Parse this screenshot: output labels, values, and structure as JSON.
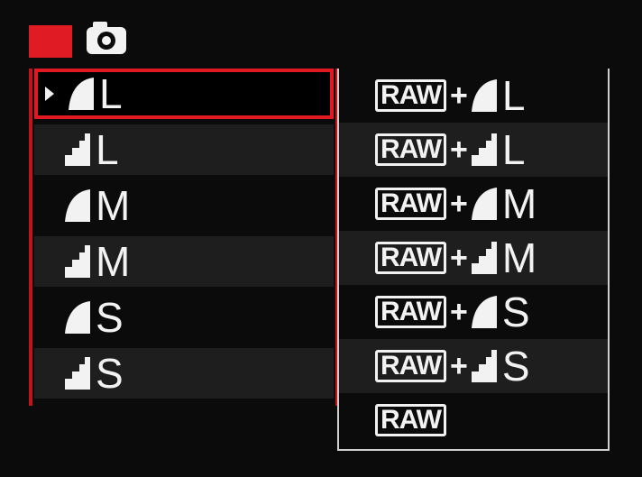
{
  "tabs": {
    "active_tab_color": "#e11b24",
    "camera_icon": "camera-icon"
  },
  "quality_menu": {
    "left_items": [
      {
        "size": "L",
        "quality": "fine"
      },
      {
        "size": "L",
        "quality": "normal"
      },
      {
        "size": "M",
        "quality": "fine"
      },
      {
        "size": "M",
        "quality": "normal"
      },
      {
        "size": "S",
        "quality": "fine"
      },
      {
        "size": "S",
        "quality": "normal"
      }
    ],
    "right_items": [
      {
        "raw": "RAW",
        "plus": "+",
        "size": "L",
        "quality": "fine"
      },
      {
        "raw": "RAW",
        "plus": "+",
        "size": "L",
        "quality": "normal"
      },
      {
        "raw": "RAW",
        "plus": "+",
        "size": "M",
        "quality": "fine"
      },
      {
        "raw": "RAW",
        "plus": "+",
        "size": "M",
        "quality": "normal"
      },
      {
        "raw": "RAW",
        "plus": "+",
        "size": "S",
        "quality": "fine"
      },
      {
        "raw": "RAW",
        "plus": "+",
        "size": "S",
        "quality": "normal"
      },
      {
        "raw": "RAW"
      }
    ],
    "selected_index": 0,
    "highlight_color": "#e21922"
  }
}
